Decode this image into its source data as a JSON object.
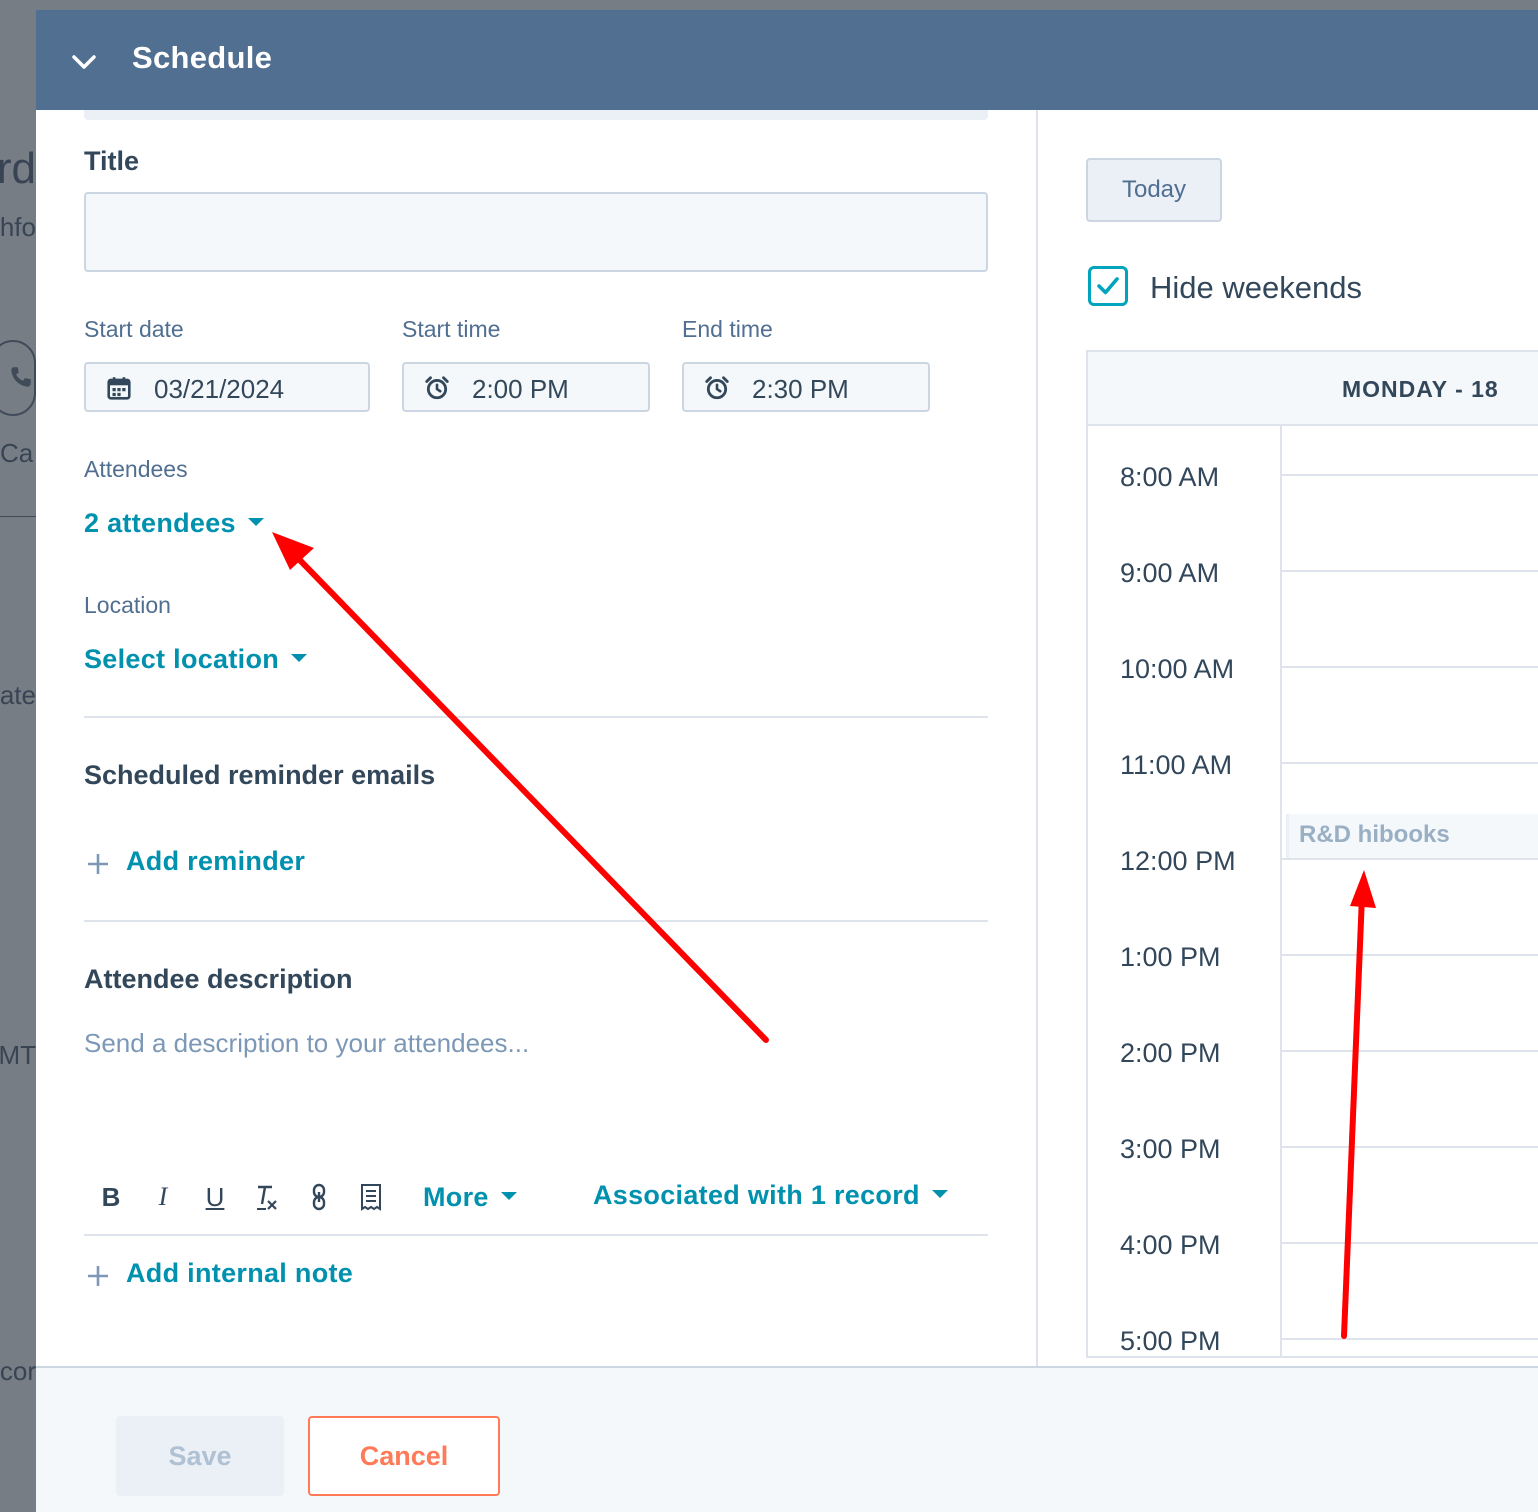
{
  "background": {
    "fragments": [
      "rd",
      "hfo",
      "Ca",
      "ate",
      "MT",
      "cor"
    ]
  },
  "header": {
    "title": "Schedule",
    "icon": "chevron-down-icon"
  },
  "form": {
    "title_label": "Title",
    "title_value": "",
    "start_date_label": "Start date",
    "start_date_value": "03/21/2024",
    "start_time_label": "Start time",
    "start_time_value": "2:00 PM",
    "end_time_label": "End time",
    "end_time_value": "2:30 PM",
    "attendees_label": "Attendees",
    "attendees_value": "2 attendees",
    "location_label": "Location",
    "location_value": "Select location",
    "reminders_heading": "Scheduled reminder emails",
    "add_reminder_label": "Add reminder",
    "description_heading": "Attendee description",
    "description_placeholder": "Send a description to your attendees...",
    "toolbar": {
      "bold": "B",
      "italic": "I",
      "underline": "U",
      "more_label": "More",
      "associated_label": "Associated with 1 record"
    },
    "add_note_label": "Add internal note"
  },
  "calendar": {
    "today_label": "Today",
    "hide_weekends_label": "Hide weekends",
    "hide_weekends_checked": true,
    "day_header": "MONDAY - 18",
    "hours": [
      "8:00 AM",
      "9:00 AM",
      "10:00 AM",
      "11:00 AM",
      "12:00 PM",
      "1:00 PM",
      "2:00 PM",
      "3:00 PM",
      "4:00 PM",
      "5:00 PM"
    ],
    "event_title": "R&D hibooks"
  },
  "footer": {
    "save_label": "Save",
    "cancel_label": "Cancel"
  },
  "colors": {
    "header": "#516f90",
    "link": "#0091ae",
    "checkbox": "#00a4bd",
    "cancel": "#ff7a59",
    "annotation": "#ff0000"
  }
}
